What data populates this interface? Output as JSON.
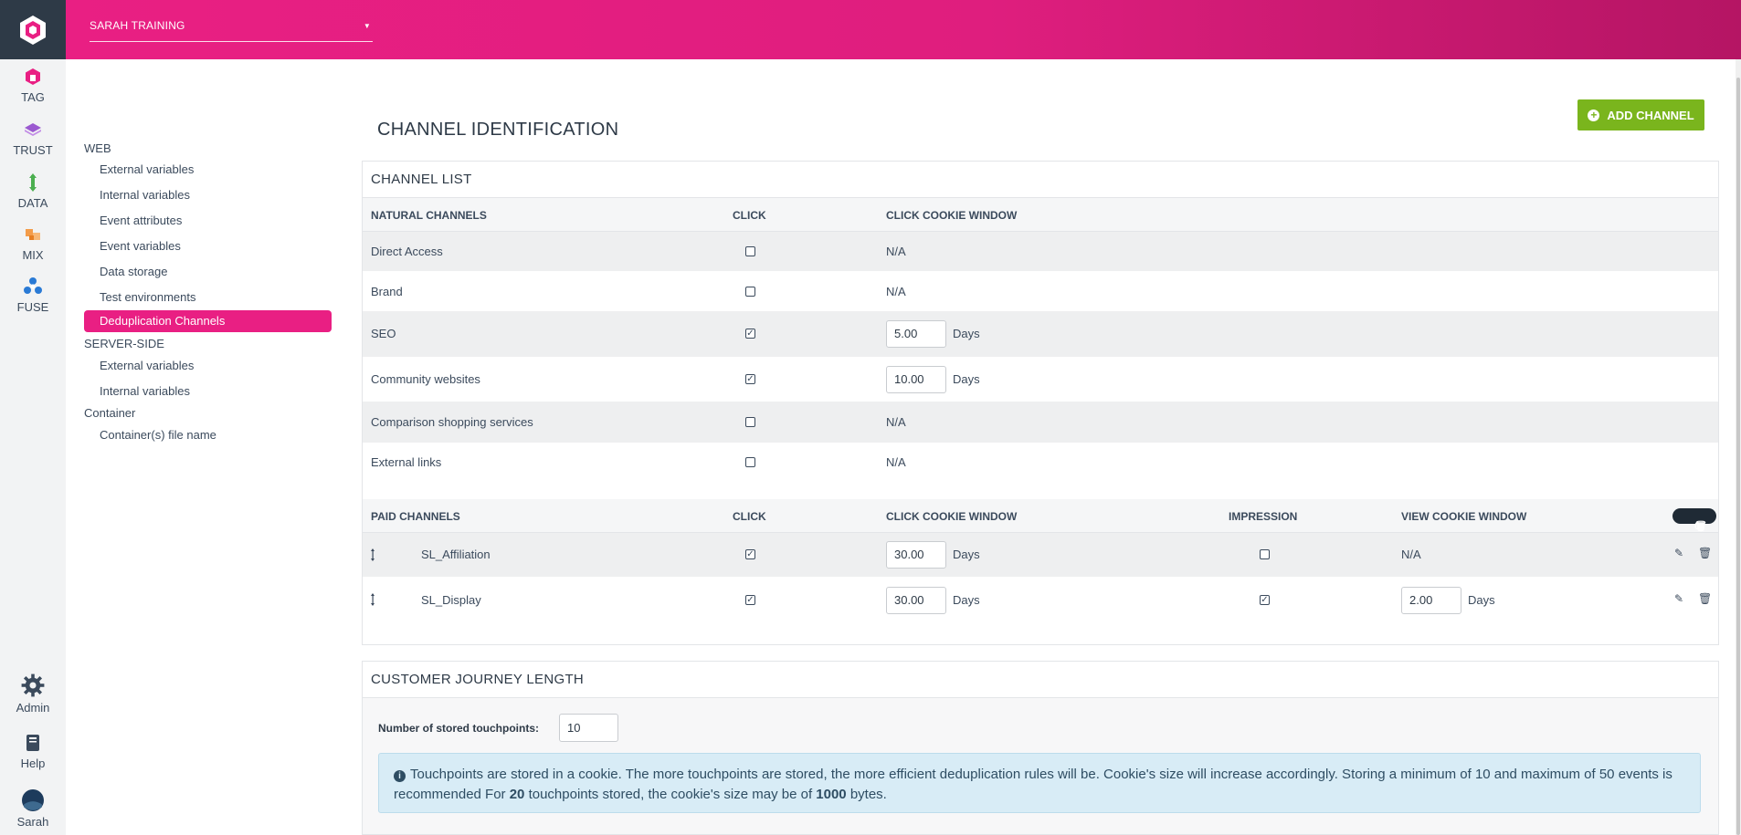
{
  "header": {
    "account": "SARAH TRAINING"
  },
  "rail": {
    "items": [
      {
        "label": "TAG",
        "icon": "tag-icon"
      },
      {
        "label": "TRUST",
        "icon": "trust-icon"
      },
      {
        "label": "DATA",
        "icon": "data-icon"
      },
      {
        "label": "MIX",
        "icon": "mix-icon"
      },
      {
        "label": "FUSE",
        "icon": "fuse-icon"
      }
    ],
    "bottom": [
      {
        "label": "Admin",
        "icon": "gear-icon"
      },
      {
        "label": "Help",
        "icon": "book-icon"
      },
      {
        "label": "Sarah",
        "icon": "avatar"
      }
    ]
  },
  "sidebar": {
    "web_label": "WEB",
    "web_items": [
      "External variables",
      "Internal variables",
      "Event attributes",
      "Event variables",
      "Data storage",
      "Test environments",
      "Deduplication Channels"
    ],
    "server_label": "SERVER-SIDE",
    "server_items": [
      "External variables",
      "Internal variables"
    ],
    "container_label": "Container",
    "container_items": [
      "Container(s) file name"
    ]
  },
  "page": {
    "title": "CHANNEL IDENTIFICATION",
    "add_button": "ADD CHANNEL"
  },
  "channel_list": {
    "title": "CHANNEL LIST",
    "natural_headers": [
      "NATURAL CHANNELS",
      "CLICK",
      "CLICK COOKIE WINDOW"
    ],
    "natural": [
      {
        "name": "Direct Access",
        "click": false,
        "window": "N/A"
      },
      {
        "name": "Brand",
        "click": false,
        "window": "N/A"
      },
      {
        "name": "SEO",
        "click": true,
        "window": "5.00",
        "unit": "Days"
      },
      {
        "name": "Community websites",
        "click": true,
        "window": "10.00",
        "unit": "Days"
      },
      {
        "name": "Comparison shopping services",
        "click": false,
        "window": "N/A"
      },
      {
        "name": "External links",
        "click": false,
        "window": "N/A"
      }
    ],
    "paid_headers": [
      "PAID CHANNELS",
      "CLICK",
      "CLICK COOKIE WINDOW",
      "IMPRESSION",
      "VIEW COOKIE WINDOW"
    ],
    "trash_badge": "0",
    "paid": [
      {
        "name": "SL_Affiliation",
        "click": true,
        "click_window": "30.00",
        "click_unit": "Days",
        "impression": false,
        "view_window": "N/A"
      },
      {
        "name": "SL_Display",
        "click": true,
        "click_window": "30.00",
        "click_unit": "Days",
        "impression": true,
        "view_window": "2.00",
        "view_unit": "Days"
      }
    ]
  },
  "journey": {
    "title": "CUSTOMER JOURNEY LENGTH",
    "touchpoints_label": "Number of stored touchpoints:",
    "touchpoints_value": "10",
    "info_part1": "Touchpoints are stored in a cookie. The more touchpoints are stored, the more efficient deduplication rules will be. Cookie's size will increase accordingly. Storing a minimum of 10 and maximum of 50 events is recommended For ",
    "info_count": "20",
    "info_part2": " touchpoints stored, the cookie's size may be of ",
    "info_size": "1000",
    "info_part3": " bytes."
  }
}
